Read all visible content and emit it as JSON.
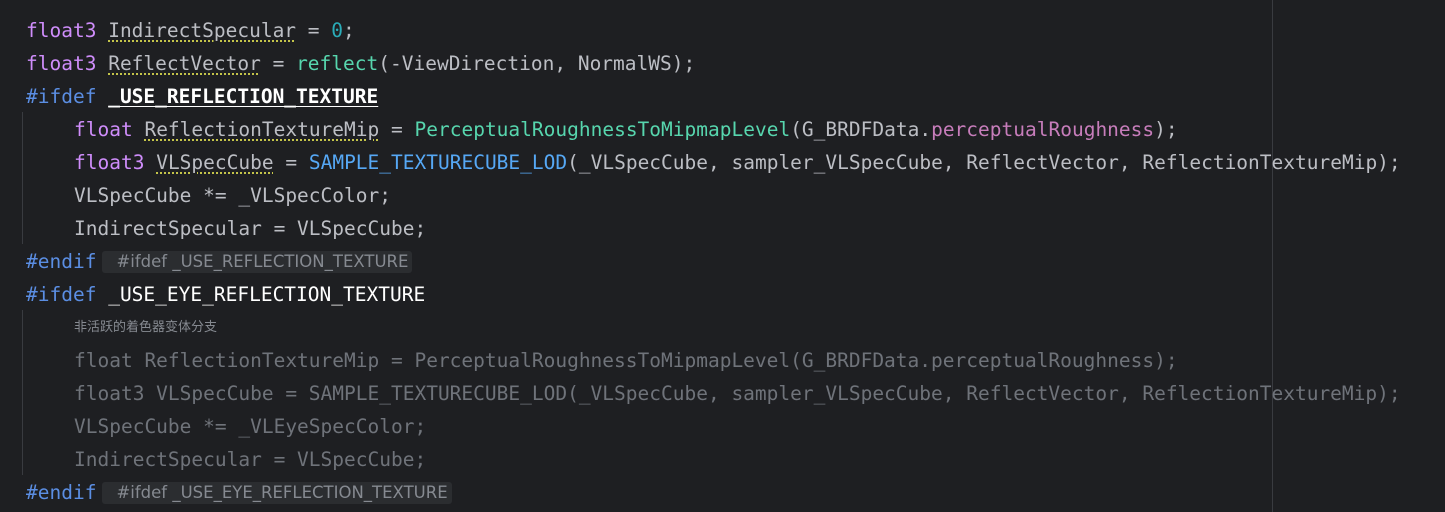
{
  "editor": {
    "line1": {
      "type": "float3",
      "name": "IndirectSpecular",
      "op": " = ",
      "value": "0",
      "end": ";"
    },
    "line2": {
      "type": "float3",
      "name": "ReflectVector",
      "op": " = ",
      "func": "reflect",
      "args": "(-ViewDirection, NormalWS);"
    },
    "line3": {
      "directive": "#ifdef",
      "symbol": "_USE_REFLECTION_TEXTURE"
    },
    "line4": {
      "type": "float",
      "name": "ReflectionTextureMip",
      "op": " = ",
      "func": "PerceptualRoughnessToMipmapLevel",
      "arg1": "(G_BRDFData.",
      "field": "perceptualRoughness",
      "end": ");"
    },
    "line5": {
      "type": "float3",
      "name": "VLSpecCube",
      "op": " = ",
      "func": "SAMPLE_TEXTURECUBE_LOD",
      "args": "(_VLSpecCube, sampler_VLSpecCube, ReflectVector, ReflectionTextureMip);"
    },
    "line6": {
      "text": "VLSpecCube *= _VLSpecColor;"
    },
    "line7": {
      "text": "IndirectSpecular = VLSpecCube;"
    },
    "line8": {
      "directive": "#endif",
      "hint": "#ifdef _USE_REFLECTION_TEXTURE"
    },
    "line9": {
      "directive": "#ifdef",
      "symbol": "_USE_EYE_REFLECTION_TEXTURE"
    },
    "inactive_label": "非活跃的着色器变体分支",
    "line10": {
      "text": "float ReflectionTextureMip = PerceptualRoughnessToMipmapLevel(G_BRDFData.perceptualRoughness);"
    },
    "line11": {
      "text": "float3 VLSpecCube = SAMPLE_TEXTURECUBE_LOD(_VLSpecCube, sampler_VLSpecCube, ReflectVector, ReflectionTextureMip);"
    },
    "line12": {
      "text": "VLSpecCube *= _VLEyeSpecColor;"
    },
    "line13": {
      "text": "IndirectSpecular = VLSpecCube;"
    },
    "line14": {
      "directive": "#endif",
      "hint": "#ifdef _USE_EYE_REFLECTION_TEXTURE"
    }
  },
  "colors": {
    "background": "#1e1f22",
    "keyword_type": "#cf8dfb",
    "preprocessor": "#5b8ee3",
    "function": "#56a8f5",
    "builtin_function": "#57d6ae",
    "number": "#2aacb8",
    "field": "#c77dbb",
    "inactive_text": "#6f737a"
  }
}
